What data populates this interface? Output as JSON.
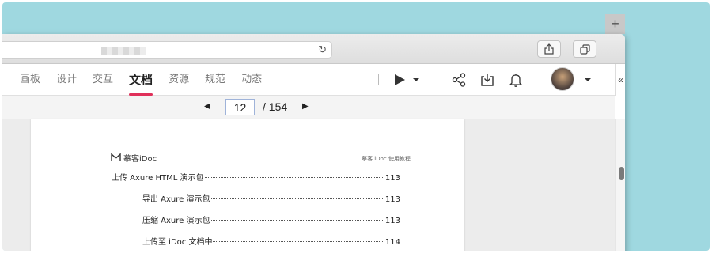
{
  "nav": {
    "items": [
      {
        "label": "画板"
      },
      {
        "label": "设计"
      },
      {
        "label": "交互"
      },
      {
        "label": "文档",
        "active": true
      },
      {
        "label": "资源"
      },
      {
        "label": "规范"
      },
      {
        "label": "动态"
      }
    ]
  },
  "pager": {
    "current_page": "12",
    "total_label": "/ 154"
  },
  "document": {
    "logo_text": "摹客iDoc",
    "header_right": "摹客 iDoc 使用教程",
    "toc": [
      {
        "title": "上传 Axure HTML  演示包",
        "page": "113",
        "level": 1
      },
      {
        "title": "导出 Axure 演示包",
        "page": "113",
        "level": 2
      },
      {
        "title": "压缩 Axure 演示包",
        "page": "113",
        "level": 2
      },
      {
        "title": "上传至 iDoc 文档中",
        "page": "114",
        "level": 2
      }
    ]
  },
  "icons": {
    "reload": "reload-icon",
    "share": "share-icon",
    "tabs": "tabs-icon",
    "play": "play-icon",
    "connect": "share-nodes-icon",
    "download": "download-icon",
    "bell": "bell-icon",
    "collapse": "collapse-icon",
    "plus": "new-tab-icon"
  },
  "colors": {
    "accent": "#e0305a",
    "desktop": "#9fd8e0"
  }
}
